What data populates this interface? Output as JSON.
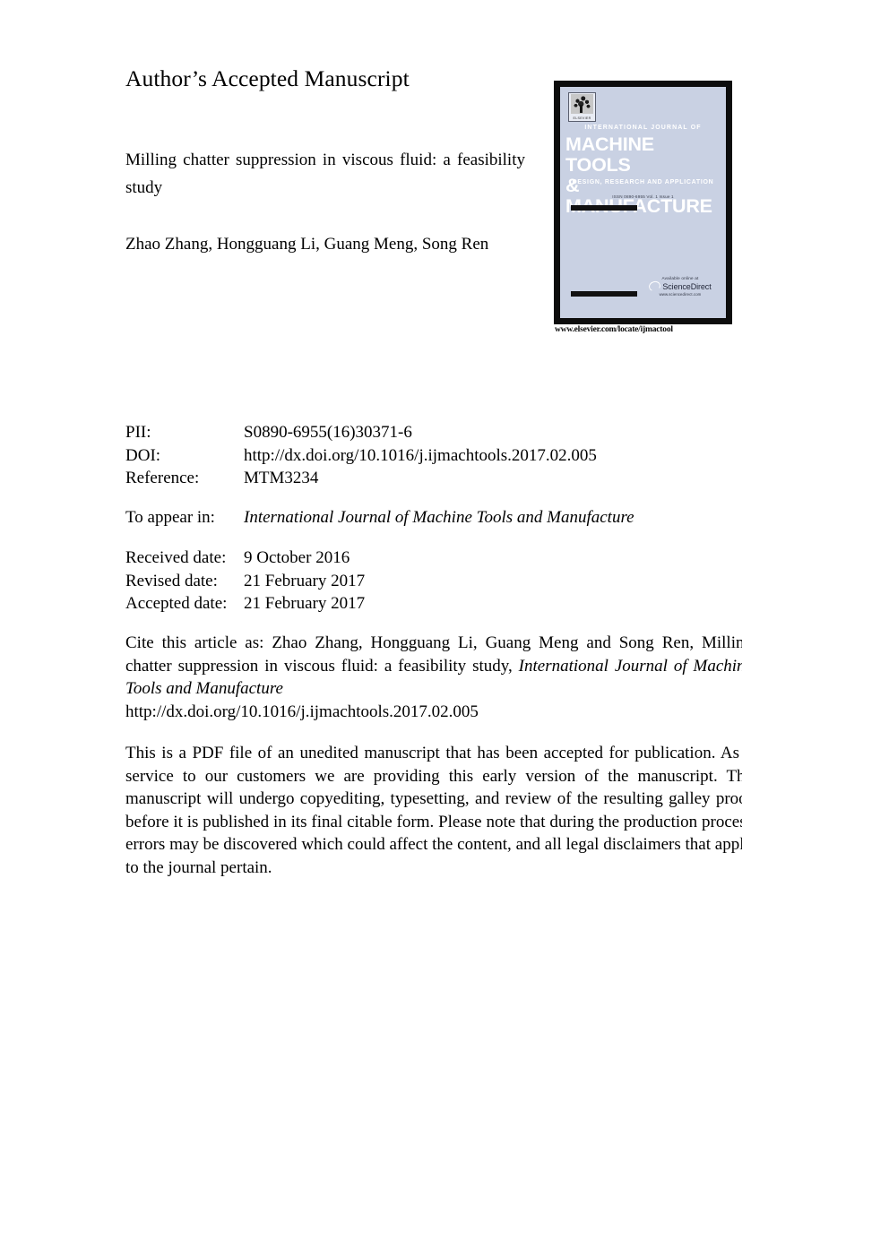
{
  "document": {
    "banner": "Author’s Accepted Manuscript",
    "paper_title": "Milling chatter suppression in viscous fluid: a feasibility study",
    "authors": "Zhao Zhang, Hongguang Li, Guang Meng, Song Ren"
  },
  "cover": {
    "publisher_mark": "ELSEVIER",
    "kicker": "INTERNATIONAL JOURNAL OF",
    "name_line1": "MACHINE TOOLS",
    "name_line2": "& MANUFACTURE",
    "subtitle": "DESIGN, RESEARCH AND APPLICATION",
    "issn": "ISSN 0890-6955   Vol. 1 Issue 1",
    "available_online": "Available online at",
    "sciencedirect": "ScienceDirect",
    "sciencedirect_url": "www.sciencedirect.com",
    "footer_url": "www.elsevier.com/locate/ijmactool"
  },
  "metadata": {
    "rows": [
      {
        "label": "PII:",
        "value": "S0890-6955(16)30371-6"
      },
      {
        "label": "DOI:",
        "value": "http://dx.doi.org/10.1016/j.ijmachtools.2017.02.005"
      },
      {
        "label": "Reference:",
        "value": "MTM3234"
      }
    ],
    "appear_label": "To appear in:",
    "appear_value": "International Journal of Machine Tools and Manufacture",
    "dates": [
      {
        "label": "Received date:",
        "value": "9 October 2016"
      },
      {
        "label": "Revised date:",
        "value": "21 February 2017"
      },
      {
        "label": "Accepted date:",
        "value": "21 February 2017"
      }
    ]
  },
  "citation": {
    "lead": "Cite this article as: Zhao Zhang, Hongguang Li, Guang Meng and Song Ren, Milling chatter suppression in viscous fluid: a feasibility study, ",
    "journal_italic": "International Journal of Machine Tools and Manufacture",
    "doi": "http://dx.doi.org/10.1016/j.ijmachtools.2017.02.005"
  },
  "disclaimer": {
    "text": "This is a PDF file of an unedited manuscript that has been accepted for publication. As a service to our customers we are providing this early version of the manuscript. The manuscript will undergo copyediting, typesetting, and review of the resulting galley proof before it is published in its final citable form. Please note that during the production process errors may be discovered which could affect the content, and all legal disclaimers that apply to the journal pertain."
  },
  "colors": {
    "cover_background": "#c9d1e3",
    "cover_border": "#0d0d0d",
    "page_background": "#ffffff",
    "text": "#000000"
  }
}
